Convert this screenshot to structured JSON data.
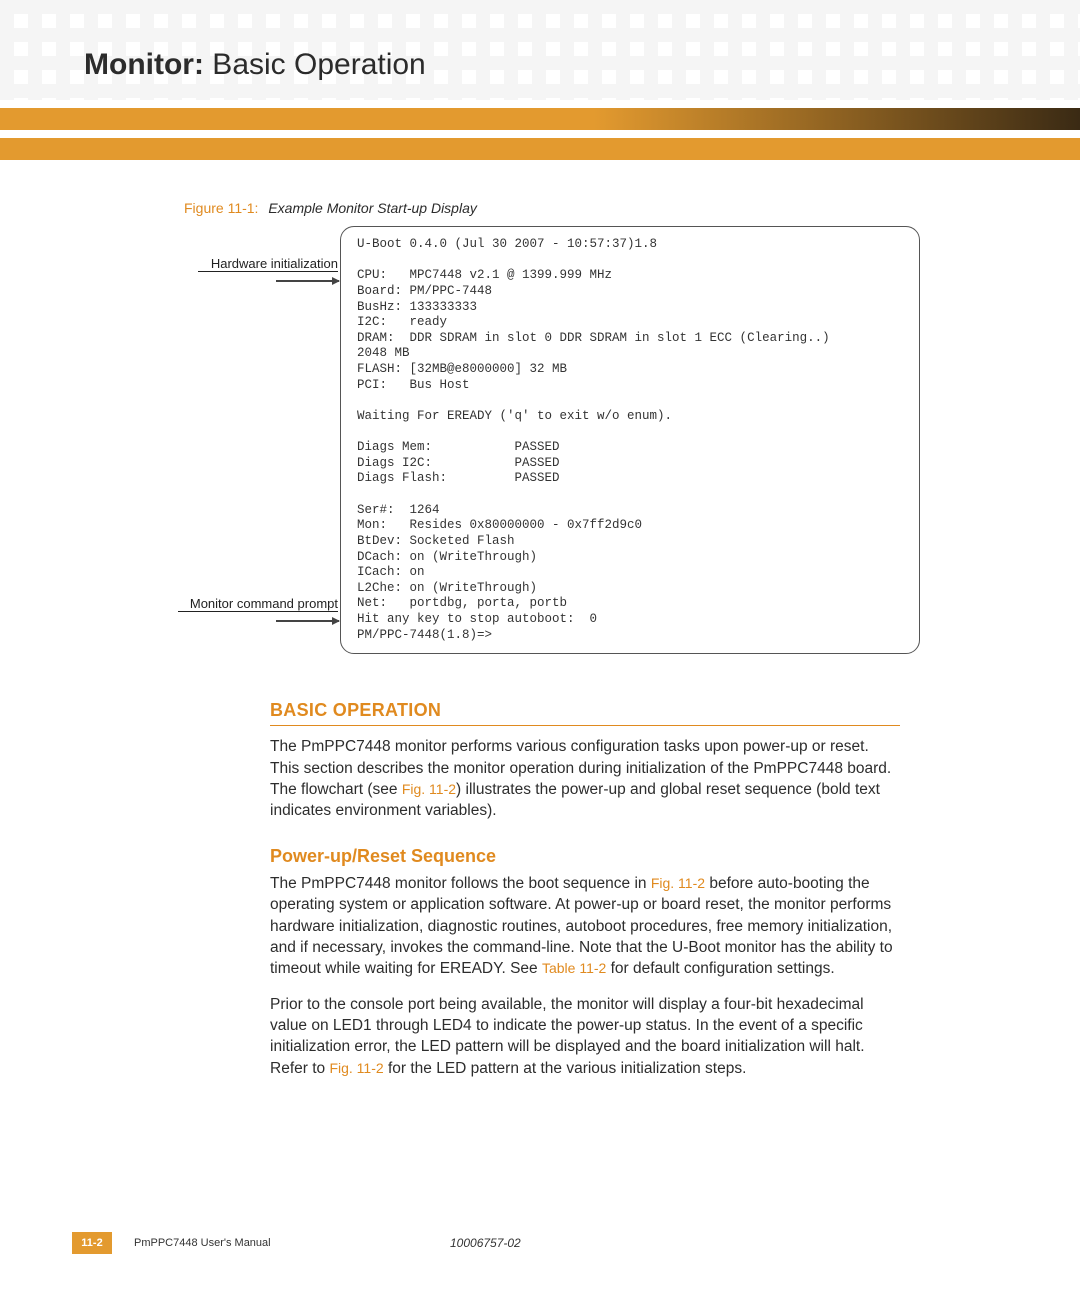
{
  "header": {
    "bold": "Monitor:",
    "rest": "  Basic Operation"
  },
  "figure": {
    "label_num": "Figure 11-1:",
    "label_title": "Example Monitor Start-up Display",
    "annot_hw": "Hardware initialization",
    "annot_prompt": "Monitor command prompt",
    "terminal": "U-Boot 0.4.0 (Jul 30 2007 - 10:57:37)1.8\n\nCPU:   MPC7448 v2.1 @ 1399.999 MHz\nBoard: PM/PPC-7448\nBusHz: 133333333\nI2C:   ready\nDRAM:  DDR SDRAM in slot 0 DDR SDRAM in slot 1 ECC (Clearing..)\n2048 MB\nFLASH: [32MB@e8000000] 32 MB\nPCI:   Bus Host\n\nWaiting For EREADY ('q' to exit w/o enum).\n\nDiags Mem:           PASSED\nDiags I2C:           PASSED\nDiags Flash:         PASSED\n\nSer#:  1264\nMon:   Resides 0x80000000 - 0x7ff2d9c0\nBtDev: Socketed Flash\nDCach: on (WriteThrough)\nICach: on\nL2Che: on (WriteThrough)\nNet:   portdbg, porta, portb\nHit any key to stop autoboot:  0\nPM/PPC-7448(1.8)=>"
  },
  "sections": {
    "basic_op_heading": "BASIC OPERATION",
    "basic_op_p1a": "The PmPPC7448 monitor performs various configuration tasks upon power-up or reset. This section describes the monitor operation during initialization of the PmPPC7448 board. The flowchart (see ",
    "basic_op_p1_link": "Fig. 11-2",
    "basic_op_p1b": ") illustrates the power-up and global reset sequence (bold text indicates environment variables).",
    "power_heading": "Power-up/Reset Sequence",
    "power_p1a": "The PmPPC7448 monitor follows the boot sequence in ",
    "power_p1_link1": "Fig. 11-2",
    "power_p1b": " before auto-booting the operating system or application software. At power-up or board reset, the monitor performs hardware initialization, diagnostic routines, autoboot procedures, free memory initialization, and if necessary, invokes the command-line. Note that the U-Boot monitor has the ability to timeout while waiting for EREADY. See ",
    "power_p1_link2": "Table 11-2",
    "power_p1c": " for default configuration settings.",
    "power_p2a": "Prior to the console port being available, the monitor will display a four-bit hexadecimal value on LED1 through LED4 to indicate the power-up status. In the event of a specific initialization error, the LED pattern will be displayed and the board initialization will halt. Refer to ",
    "power_p2_link": "Fig. 11-2",
    "power_p2b": " for the LED pattern at the various initialization steps."
  },
  "footer": {
    "page": "11-2",
    "manual": "PmPPC7448 User's Manual",
    "docnum": "10006757-02"
  }
}
